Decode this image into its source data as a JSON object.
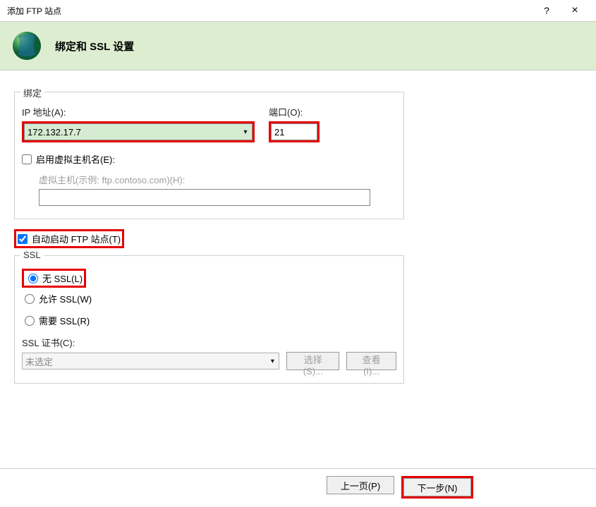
{
  "window": {
    "title": "添加 FTP 站点",
    "help": "?",
    "close": "×"
  },
  "header": {
    "title": "绑定和 SSL 设置"
  },
  "binding": {
    "legend": "绑定",
    "ip_label": "IP 地址(A):",
    "ip_value": "172.132.17.7",
    "port_label": "端口(O):",
    "port_value": "21",
    "enable_vhost_label": "启用虚拟主机名(E):",
    "enable_vhost_checked": false,
    "vhost_label": "虚拟主机(示例: ftp.contoso.com)(H):",
    "vhost_value": ""
  },
  "auto_start": {
    "label": "自动启动 FTP 站点(T)",
    "checked": true
  },
  "ssl": {
    "legend": "SSL",
    "no_ssl": "无 SSL(L)",
    "allow_ssl": "允许 SSL(W)",
    "require_ssl": "需要 SSL(R)",
    "selected": "no",
    "cert_label": "SSL 证书(C):",
    "cert_placeholder": "未选定",
    "select_btn": "选择(S)...",
    "view_btn": "查看(I)..."
  },
  "footer": {
    "prev": "上一页(P)",
    "next": "下一步(N)"
  }
}
